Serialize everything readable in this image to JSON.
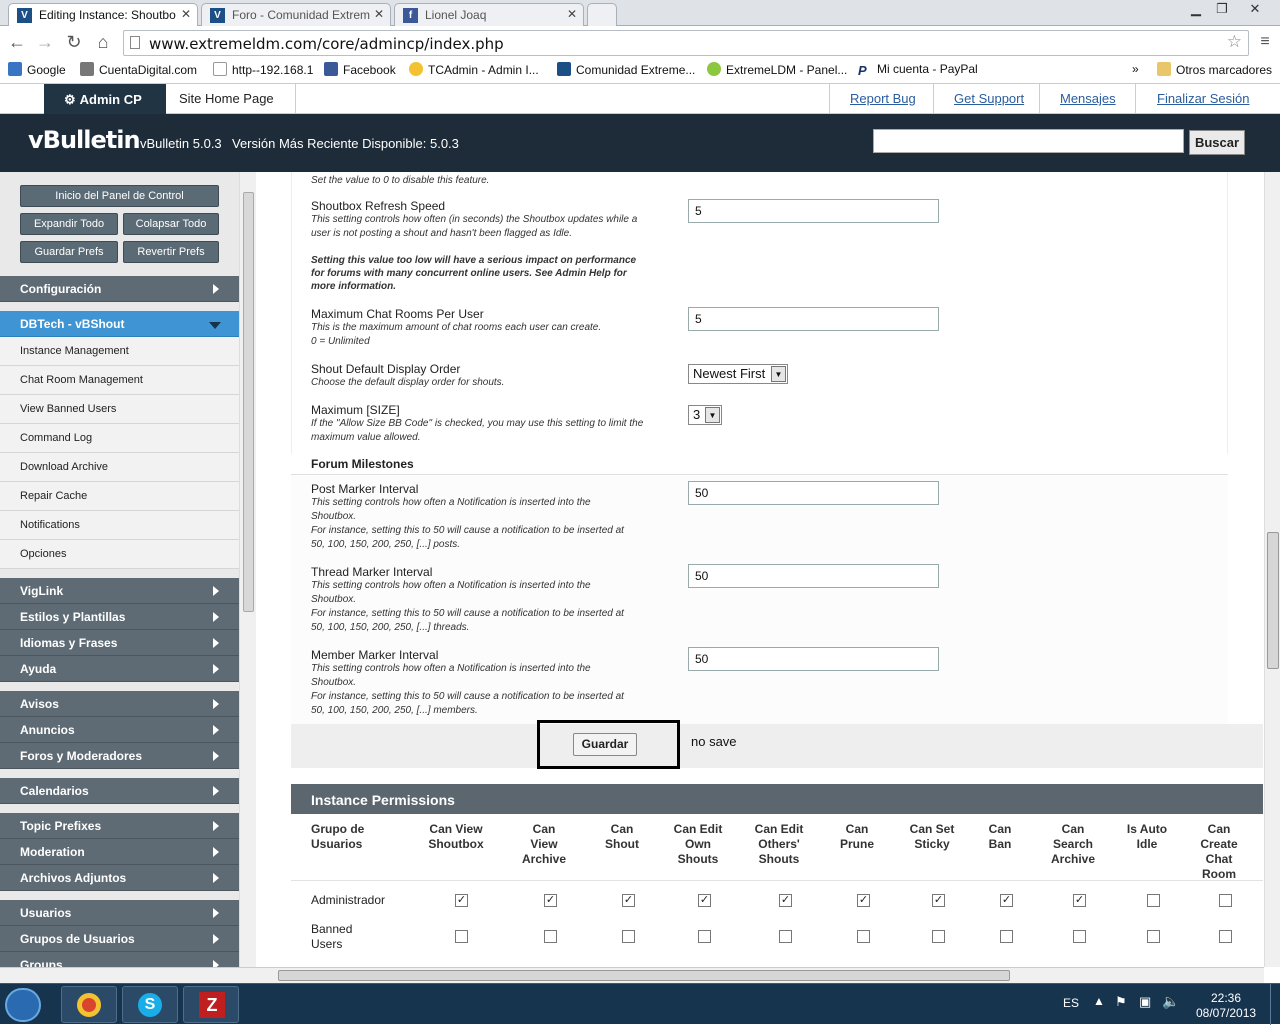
{
  "browser": {
    "tabs": [
      {
        "title": "Editing Instance: Shoutbo",
        "favicon": "V"
      },
      {
        "title": "Foro - Comunidad Extrem",
        "favicon": "V"
      },
      {
        "title": "Lionel Joaq",
        "favicon": "f"
      }
    ],
    "url": "www.extremeldm.com/core/admincp/index.php",
    "bookmarks": [
      "Google",
      "CuentaDigital.com",
      "http--192.168.1",
      "Facebook",
      "TCAdmin - Admin I...",
      "Comunidad Extreme...",
      "ExtremeLDM - Panel...",
      "Mi cuenta - PayPal"
    ],
    "bookmarks_more": "»",
    "other_bookmarks": "Otros marcadores"
  },
  "adminnav": {
    "admincp": "Admin CP",
    "site_home": "Site Home Page",
    "links": [
      "Report Bug",
      "Get Support",
      "Mensajes",
      "Finalizar Sesión"
    ]
  },
  "header": {
    "logo": "vBulletin",
    "version": "vBulletin 5.0.3",
    "latest": "Versión Más Reciente Disponible: 5.0.3",
    "search_button": "Buscar"
  },
  "sidebar": {
    "buttons": {
      "home": "Inicio del Panel de Control",
      "expand": "Expandir Todo",
      "collapse": "Colapsar Todo",
      "save_prefs": "Guardar Prefs",
      "revert_prefs": "Revertir Prefs"
    },
    "categories_top": [
      "Configuración"
    ],
    "open_category": "DBTech - vBShout",
    "sub_items": [
      "Instance Management",
      "Chat Room Management",
      "View Banned Users",
      "Command Log",
      "Download Archive",
      "Repair Cache",
      "Notifications",
      "Opciones"
    ],
    "categories_bottom": [
      "VigLink",
      "Estilos y Plantillas",
      "Idiomas y Frases",
      "Ayuda",
      "Avisos",
      "Anuncios",
      "Foros y Moderadores",
      "Calendarios",
      "Topic Prefixes",
      "Moderation",
      "Archivos Adjuntos",
      "Usuarios",
      "Grupos de Usuarios",
      "Groups"
    ]
  },
  "settings": {
    "top_desc": "Set the value to 0 to disable this feature.",
    "refresh": {
      "title": "Shoutbox Refresh Speed",
      "desc": "This setting controls how often (in seconds) the Shoutbox updates while a user is not posting a shout and hasn't been flagged as Idle.",
      "warning": "Setting this value too low will have a serious impact on performance for forums with many concurrent online users. See Admin Help for more information.",
      "value": "5"
    },
    "max_rooms": {
      "title": "Maximum Chat Rooms Per User",
      "desc": "This is the maximum amount of chat rooms each user can create.",
      "desc2": "0 = Unlimited",
      "value": "5"
    },
    "display_order": {
      "title": "Shout Default Display Order",
      "desc": "Choose the default display order for shouts.",
      "value": "Newest First"
    },
    "max_size": {
      "title": "Maximum [SIZE]",
      "desc": "If the \"Allow Size BB Code\" is checked, you may use this setting to limit the maximum value allowed.",
      "value": "3"
    },
    "milestones_heading": "Forum Milestones",
    "post_marker": {
      "title": "Post Marker Interval",
      "desc": "This setting controls how often a Notification is inserted into the Shoutbox.",
      "desc2": "For instance, setting this to 50 will cause a notification to be inserted at 50, 100, 150, 200, 250, [...] posts.",
      "value": "50"
    },
    "thread_marker": {
      "title": "Thread Marker Interval",
      "desc": "This setting controls how often a Notification is inserted into the Shoutbox.",
      "desc2": "For instance, setting this to 50 will cause a notification to be inserted at 50, 100, 150, 200, 250, [...] threads.",
      "value": "50"
    },
    "member_marker": {
      "title": "Member Marker Interval",
      "desc": "This setting controls how often a Notification is inserted into the Shoutbox.",
      "desc2": "For instance, setting this to 50 will cause a notification to be inserted at 50, 100, 150, 200, 250, [...] members.",
      "value": "50"
    },
    "save_button": "Guardar",
    "annotation": "no save"
  },
  "permissions": {
    "title": "Instance Permissions",
    "group_header": "Grupo de Usuarios",
    "columns": [
      "Can View Shoutbox",
      "Can View Archive",
      "Can Shout",
      "Can Edit Own Shouts",
      "Can Edit Others' Shouts",
      "Can Prune",
      "Can Set Sticky",
      "Can Ban",
      "Can Search Archive",
      "Is Auto Idle",
      "Can Create Chat Room"
    ],
    "rows": [
      {
        "group": "Administrador",
        "checks": [
          true,
          true,
          true,
          true,
          true,
          true,
          true,
          true,
          true,
          false,
          false
        ]
      },
      {
        "group": "Banned Users",
        "checks": [
          false,
          false,
          false,
          false,
          false,
          false,
          false,
          false,
          false,
          false,
          false
        ]
      }
    ]
  },
  "taskbar": {
    "lang": "ES",
    "time": "22:36",
    "date": "08/07/2013"
  },
  "colors": {
    "header_bg": "#1d2c38",
    "sidebar_cat": "#5e6b74",
    "sidebar_open": "#3f95d4",
    "link": "#2a5d9e"
  }
}
